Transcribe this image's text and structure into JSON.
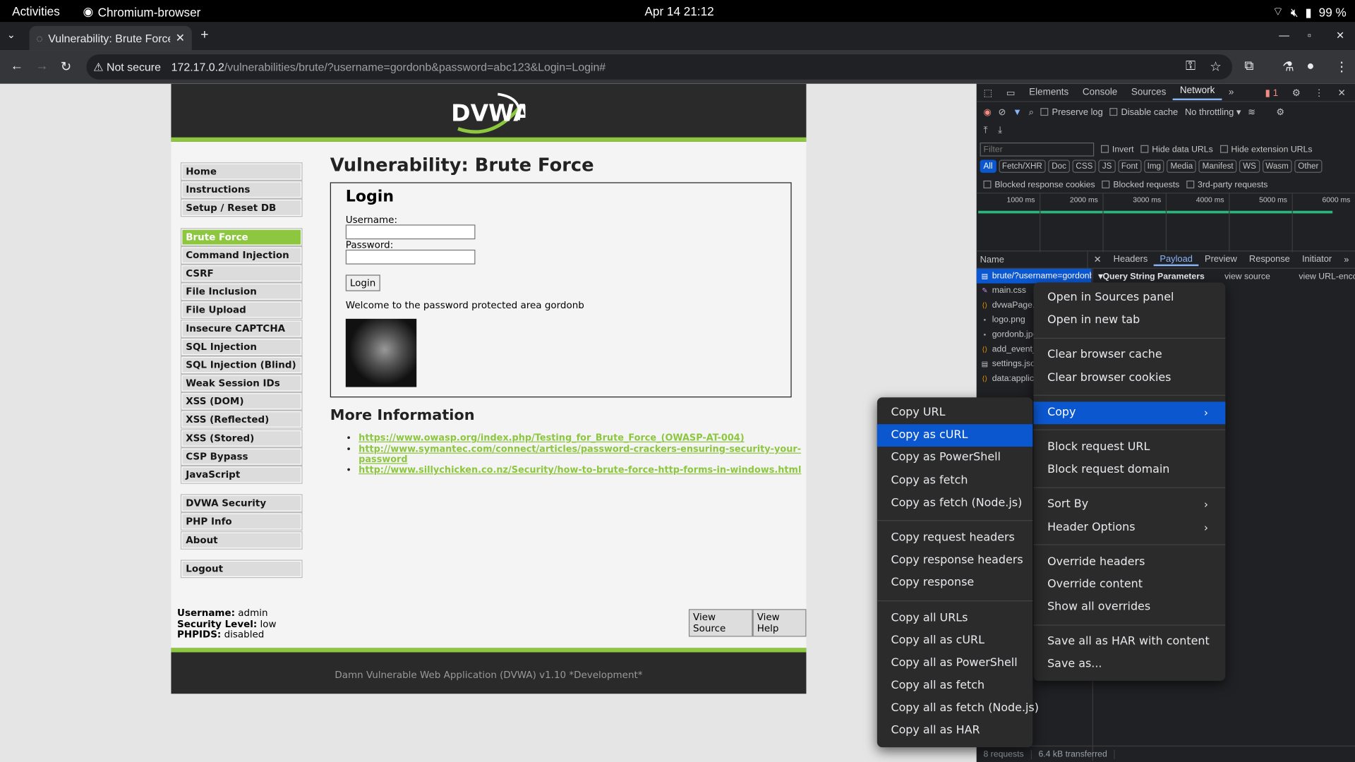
{
  "system": {
    "activities": "Activities",
    "app_name": "Chromium-browser",
    "clock": "Apr 14  21:12",
    "battery": "99 %"
  },
  "browser": {
    "tab_title": "Vulnerability: Brute Force",
    "not_secure": "Not secure",
    "url_host": "172.17.0.2",
    "url_path": "/vulnerabilities/brute/?username=gordonb&password=abc123&Login=Login#"
  },
  "dvwa": {
    "logo_text": "DVWA",
    "menu": {
      "group1": [
        "Home",
        "Instructions",
        "Setup / Reset DB"
      ],
      "group2": [
        "Brute Force",
        "Command Injection",
        "CSRF",
        "File Inclusion",
        "File Upload",
        "Insecure CAPTCHA",
        "SQL Injection",
        "SQL Injection (Blind)",
        "Weak Session IDs",
        "XSS (DOM)",
        "XSS (Reflected)",
        "XSS (Stored)",
        "CSP Bypass",
        "JavaScript"
      ],
      "group3": [
        "DVWA Security",
        "PHP Info",
        "About"
      ],
      "group4": [
        "Logout"
      ],
      "active": "Brute Force"
    },
    "page_title": "Vulnerability: Brute Force",
    "login": {
      "heading": "Login",
      "username_label": "Username:",
      "password_label": "Password:",
      "button": "Login",
      "welcome": "Welcome to the password protected area gordonb"
    },
    "more_info_title": "More Information",
    "links": [
      "https://www.owasp.org/index.php/Testing_for_Brute_Force_(OWASP-AT-004)",
      "http://www.symantec.com/connect/articles/password-crackers-ensuring-security-your-password",
      "http://www.sillychicken.co.nz/Security/how-to-brute-force-http-forms-in-windows.html"
    ],
    "status": {
      "username_label": "Username:",
      "username": "admin",
      "security_label": "Security Level:",
      "security": "low",
      "phpids_label": "PHPIDS:",
      "phpids": "disabled"
    },
    "view_source": "View Source",
    "view_help": "View Help",
    "footer": "Damn Vulnerable Web Application (DVWA) v1.10 *Development*"
  },
  "devtools": {
    "tabs": [
      "Elements",
      "Console",
      "Sources",
      "Network"
    ],
    "active_tab": "Network",
    "issues_count": "1",
    "preserve_log": "Preserve log",
    "disable_cache": "Disable cache",
    "throttling": "No throttling",
    "filter_placeholder": "Filter",
    "invert": "Invert",
    "hide_data_urls": "Hide data URLs",
    "hide_extension_urls": "Hide extension URLs",
    "types": [
      "All",
      "Fetch/XHR",
      "Doc",
      "CSS",
      "JS",
      "Font",
      "Img",
      "Media",
      "Manifest",
      "WS",
      "Wasm",
      "Other"
    ],
    "blocked_cookies": "Blocked response cookies",
    "blocked_requests": "Blocked requests",
    "third_party": "3rd-party requests",
    "ticks": [
      "1000 ms",
      "2000 ms",
      "3000 ms",
      "4000 ms",
      "5000 ms",
      "6000 ms"
    ],
    "name_header": "Name",
    "detail_tabs": [
      "Headers",
      "Payload",
      "Preview",
      "Response",
      "Initiator"
    ],
    "active_detail_tab": "Payload",
    "requests": [
      "brute/?username=gordonb",
      "main.css",
      "dvwaPage.js",
      "logo.png",
      "gordonb.jpg",
      "add_event_listeners.js",
      "settings.json",
      "data:application"
    ],
    "query_string_params": "Query String Parameters",
    "view_source": "view source",
    "view_url_encoded": "view URL-encoded",
    "requests_count": "8 requests",
    "transferred": "6.4 kB transferred"
  },
  "context_menu_main": {
    "items": [
      "Open in Sources panel",
      "Open in new tab",
      "Clear browser cache",
      "Clear browser cookies",
      "Copy",
      "Block request URL",
      "Block request domain",
      "Sort By",
      "Header Options",
      "Override headers",
      "Override content",
      "Show all overrides",
      "Save all as HAR with content",
      "Save as..."
    ],
    "highlighted": "Copy"
  },
  "context_menu_copy": {
    "items": [
      "Copy URL",
      "Copy as cURL",
      "Copy as PowerShell",
      "Copy as fetch",
      "Copy as fetch (Node.js)",
      "Copy request headers",
      "Copy response headers",
      "Copy response",
      "Copy all URLs",
      "Copy all as cURL",
      "Copy all as PowerShell",
      "Copy all as fetch",
      "Copy all as fetch (Node.js)",
      "Copy all as HAR"
    ],
    "highlighted": "Copy as cURL"
  }
}
